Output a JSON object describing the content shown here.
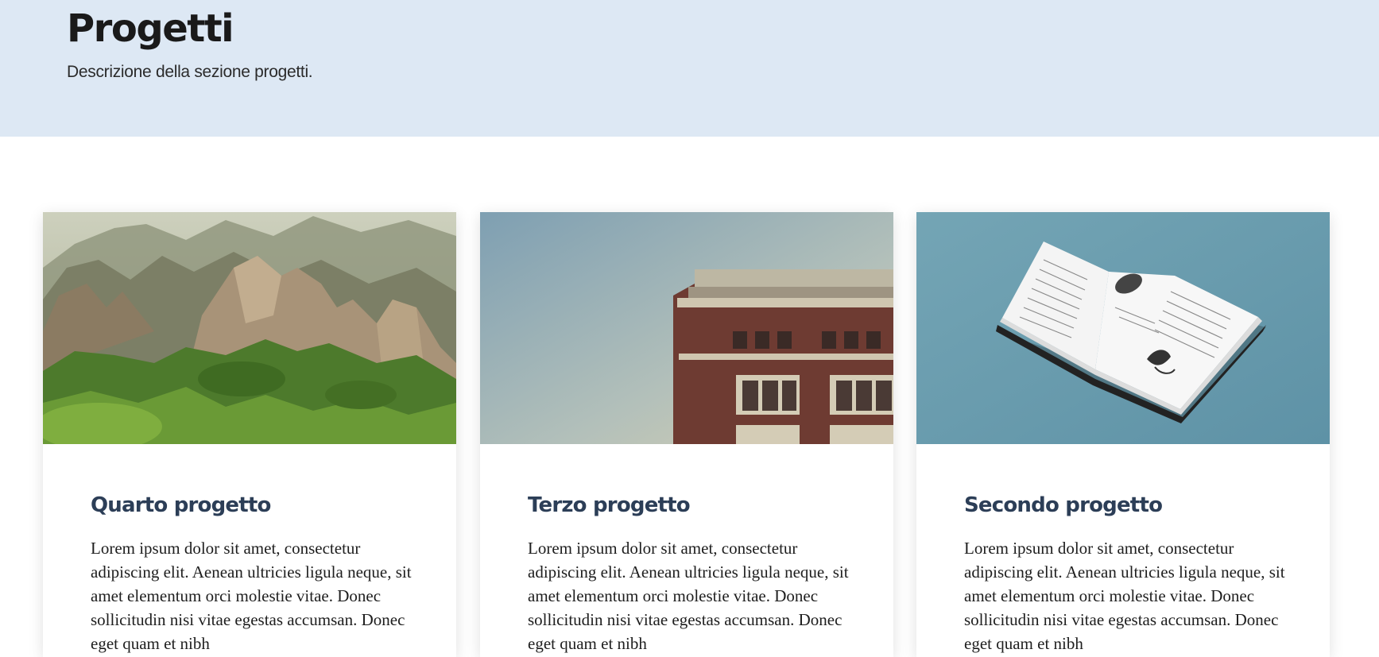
{
  "header": {
    "title": "Progetti",
    "description": "Descrizione della sezione progetti."
  },
  "cards": [
    {
      "title": "Quarto progetto",
      "image": "mountain-landscape-photo",
      "text": "Lorem ipsum dolor sit amet, consectetur adipiscing elit. Aenean ultricies ligula neque, sit amet elementum orci molestie vitae. Donec sollicitudin nisi vitae egestas accumsan. Donec eget quam et nibh"
    },
    {
      "title": "Terzo progetto",
      "image": "building-facade-photo",
      "text": "Lorem ipsum dolor sit amet, consectetur adipiscing elit. Aenean ultricies ligula neque, sit amet elementum orci molestie vitae. Donec sollicitudin nisi vitae egestas accumsan. Donec eget quam et nibh"
    },
    {
      "title": "Secondo progetto",
      "image": "open-book-photo",
      "text": "Lorem ipsum dolor sit amet, consectetur adipiscing elit. Aenean ultricies ligula neque, sit amet elementum orci molestie vitae. Donec sollicitudin nisi vitae egestas accumsan. Donec eget quam et nibh"
    }
  ],
  "colors": {
    "hero_background": "#dde8f4",
    "card_title": "#2c3e57",
    "book_background": "#6a9db0"
  }
}
